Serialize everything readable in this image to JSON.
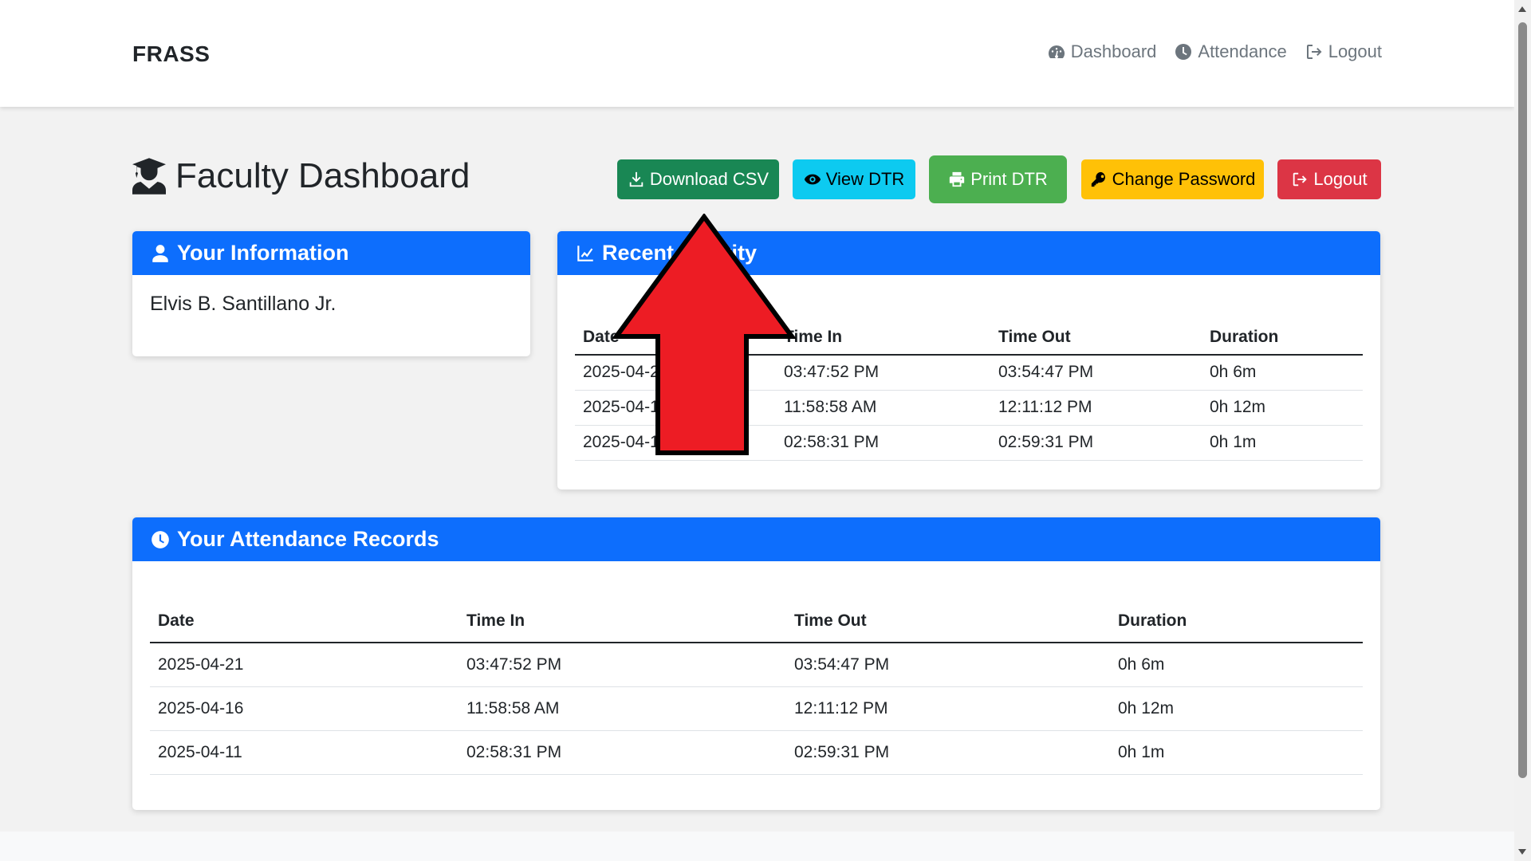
{
  "navbar": {
    "brand": "FRASS",
    "links": [
      {
        "label": "Dashboard",
        "icon": "gauge-icon"
      },
      {
        "label": "Attendance",
        "icon": "clock-icon"
      },
      {
        "label": "Logout",
        "icon": "sign-out-icon"
      }
    ]
  },
  "page": {
    "title": "Faculty Dashboard",
    "title_icon": "graduate-icon"
  },
  "actions": {
    "download_csv": "Download CSV",
    "view_dtr": "View DTR",
    "print_dtr": "Print DTR",
    "change_password": "Change Password",
    "logout": "Logout"
  },
  "info_card": {
    "title": "Your Information",
    "name": "Elvis B. Santillano Jr."
  },
  "recent_card": {
    "title": "Recent Activity",
    "columns": [
      "Date",
      "Time In",
      "Time Out",
      "Duration"
    ],
    "rows": [
      [
        "2025-04-21",
        "03:47:52 PM",
        "03:54:47 PM",
        "0h 6m"
      ],
      [
        "2025-04-16",
        "11:58:58 AM",
        "12:11:12 PM",
        "0h 12m"
      ],
      [
        "2025-04-11",
        "02:58:31 PM",
        "02:59:31 PM",
        "0h 1m"
      ]
    ]
  },
  "records_card": {
    "title": "Your Attendance Records",
    "columns": [
      "Date",
      "Time In",
      "Time Out",
      "Duration"
    ],
    "rows": [
      [
        "2025-04-21",
        "03:47:52 PM",
        "03:54:47 PM",
        "0h 6m"
      ],
      [
        "2025-04-16",
        "11:58:58 AM",
        "12:11:12 PM",
        "0h 12m"
      ],
      [
        "2025-04-11",
        "02:58:31 PM",
        "02:59:31 PM",
        "0h 1m"
      ]
    ]
  },
  "colors": {
    "primary": "#0d6efd",
    "success": "#198754",
    "info": "#0dcaf0",
    "print": "#4caf50",
    "warning": "#ffc107",
    "danger": "#dc3545",
    "arrow": "#ed1c24"
  }
}
